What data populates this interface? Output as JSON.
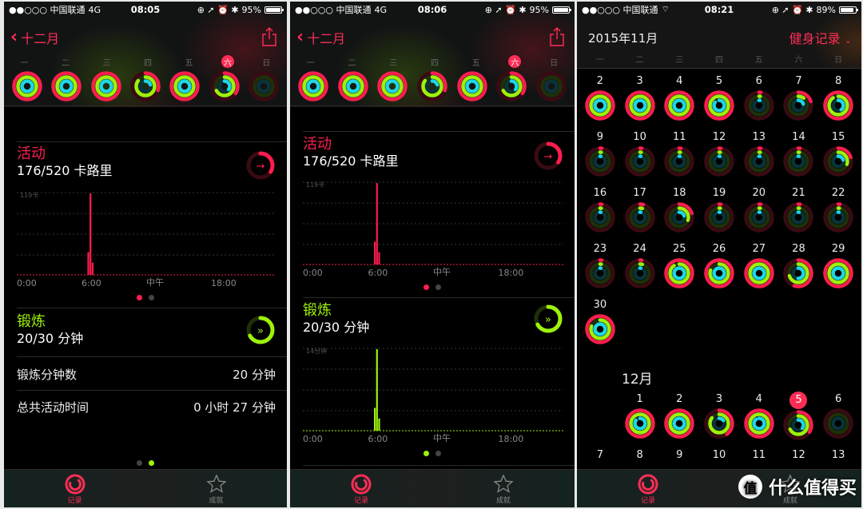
{
  "colors": {
    "move": "#fa1e4e",
    "exercise": "#9ef20a",
    "stand": "#1ed6e6",
    "accent": "#ff2d55",
    "inactive_dot": "#444444"
  },
  "screens": [
    {
      "status": {
        "carrier": "●●○○○ 中国联通",
        "network": "4G",
        "time": "08:05",
        "battery": "95%",
        "battery_level": 0.95
      },
      "nav": {
        "back_label": "十二月"
      },
      "weekdays": [
        "一",
        "二",
        "三",
        "四",
        "五",
        "六",
        "日"
      ],
      "selected_weekday": 5,
      "week_rings": [
        {
          "move": 1.0,
          "exercise": 1.0,
          "stand": 1.0
        },
        {
          "move": 1.0,
          "exercise": 1.0,
          "stand": 1.0
        },
        {
          "move": 1.0,
          "exercise": 1.0,
          "stand": 1.0
        },
        {
          "move": 0.3,
          "exercise": 0.85,
          "stand": 0.2
        },
        {
          "move": 1.0,
          "exercise": 1.0,
          "stand": 1.0
        },
        {
          "move": 0.34,
          "exercise": 0.67,
          "stand": 0.35
        },
        {
          "move": 0,
          "exercise": 0,
          "stand": 0
        }
      ],
      "activity": {
        "title": "活动",
        "value": "176/520 卡路里",
        "progress": 0.34,
        "chart_max_label": "119卡",
        "x_labels": [
          "0:00",
          "6:00",
          "中午",
          "18:00"
        ]
      },
      "exercise": {
        "title": "锻炼",
        "value": "20/30 分钟",
        "progress": 0.67
      },
      "details": [
        {
          "label": "锻炼分钟数",
          "value": "20 分钟"
        },
        {
          "label": "总共活动时间",
          "value": "0 小时 27 分钟"
        }
      ],
      "page_dots_active": 1,
      "tabs": [
        {
          "label": "记录",
          "active": true
        },
        {
          "label": "成就",
          "active": false
        }
      ]
    },
    {
      "status": {
        "carrier": "●●○○○ 中国联通",
        "network": "4G",
        "time": "08:06",
        "battery": "95%",
        "battery_level": 0.95
      },
      "nav": {
        "back_label": "十二月"
      },
      "weekdays": [
        "一",
        "二",
        "三",
        "四",
        "五",
        "六",
        "日"
      ],
      "selected_weekday": 5,
      "activity": {
        "title": "活动",
        "value": "176/520 卡路里",
        "progress": 0.34,
        "chart_max_label": "119卡",
        "x_labels": [
          "0:00",
          "6:00",
          "中午",
          "18:00"
        ]
      },
      "exercise": {
        "title": "锻炼",
        "value": "20/30 分钟",
        "progress": 0.67,
        "chart_max_label": "14分钟",
        "x_labels": [
          "0:00",
          "6:00",
          "中午",
          "18:00"
        ]
      },
      "tabs": [
        {
          "label": "记录",
          "active": true
        },
        {
          "label": "成就",
          "active": false
        }
      ]
    },
    {
      "status": {
        "carrier": "●●○○○ 中国联通",
        "network": "wifi",
        "time": "08:21",
        "battery": "89%",
        "battery_level": 0.89
      },
      "header": {
        "month": "2015年11月",
        "filter": "健身记录"
      },
      "weekdays": [
        "一",
        "二",
        "三",
        "四",
        "五",
        "六",
        "日"
      ],
      "nov_weeks": [
        [
          "2",
          "3",
          "4",
          "5",
          "6",
          "7",
          "8"
        ],
        [
          "9",
          "10",
          "11",
          "12",
          "13",
          "14",
          "15"
        ],
        [
          "16",
          "17",
          "18",
          "19",
          "20",
          "21",
          "22"
        ],
        [
          "23",
          "24",
          "25",
          "26",
          "27",
          "28",
          "29"
        ],
        [
          "30"
        ]
      ],
      "nov_rings": {
        "2": [
          1,
          1,
          1
        ],
        "3": [
          1,
          1,
          1
        ],
        "4": [
          1,
          1,
          1
        ],
        "5": [
          1,
          1,
          0.85
        ],
        "6": [
          0.02,
          0.02,
          0.02
        ],
        "7": [
          0.2,
          0.1,
          0.2
        ],
        "8": [
          1,
          0.9,
          0.4
        ],
        "9": [
          0.02,
          0.02,
          0.02
        ],
        "10": [
          0.02,
          0.02,
          0.02
        ],
        "11": [
          0.02,
          0.02,
          0.02
        ],
        "12": [
          0.02,
          0.02,
          0.02
        ],
        "13": [
          0.02,
          0.02,
          0.02
        ],
        "14": [
          0.02,
          0.02,
          0.02
        ],
        "15": [
          0.2,
          0.3,
          0.2
        ],
        "16": [
          0.02,
          0.02,
          0.02
        ],
        "17": [
          0.04,
          0.04,
          0.02
        ],
        "18": [
          0.2,
          0.3,
          0.2
        ],
        "19": [
          0.02,
          0.02,
          0.02
        ],
        "20": [
          0.02,
          0.02,
          0.02
        ],
        "21": [
          0.02,
          0.02,
          0.02
        ],
        "22": [
          0.02,
          0.02,
          0.02
        ],
        "23": [
          0.02,
          0.02,
          0.02
        ],
        "24": [
          0.02,
          0.04,
          0.02
        ],
        "25": [
          1,
          0.9,
          1
        ],
        "26": [
          1,
          0.8,
          1
        ],
        "27": [
          1,
          1,
          1
        ],
        "28": [
          0.55,
          0.7,
          0.5
        ],
        "29": [
          1,
          1,
          1
        ],
        "30": [
          1,
          0.8,
          1
        ]
      },
      "dec_label": "12月",
      "dec_week": [
        "",
        "1",
        "2",
        "3",
        "4",
        "5",
        "6"
      ],
      "dec_today": "5",
      "dec_rings": {
        "1": [
          1,
          1,
          0.85
        ],
        "2": [
          1,
          1,
          1
        ],
        "3": [
          0.4,
          0.85,
          0.15
        ],
        "4": [
          1,
          1,
          0.9
        ],
        "5": [
          0.34,
          0.67,
          0.35
        ],
        "6": [
          0,
          0,
          0
        ]
      },
      "dec_next_week": [
        "7",
        "8",
        "9",
        "10",
        "11",
        "12",
        "13"
      ],
      "tabs": [
        {
          "label": "记录",
          "active": true
        },
        {
          "label": "成就",
          "active": false
        }
      ],
      "watermark": {
        "logo": "值",
        "text": "什么值得买"
      }
    }
  ]
}
